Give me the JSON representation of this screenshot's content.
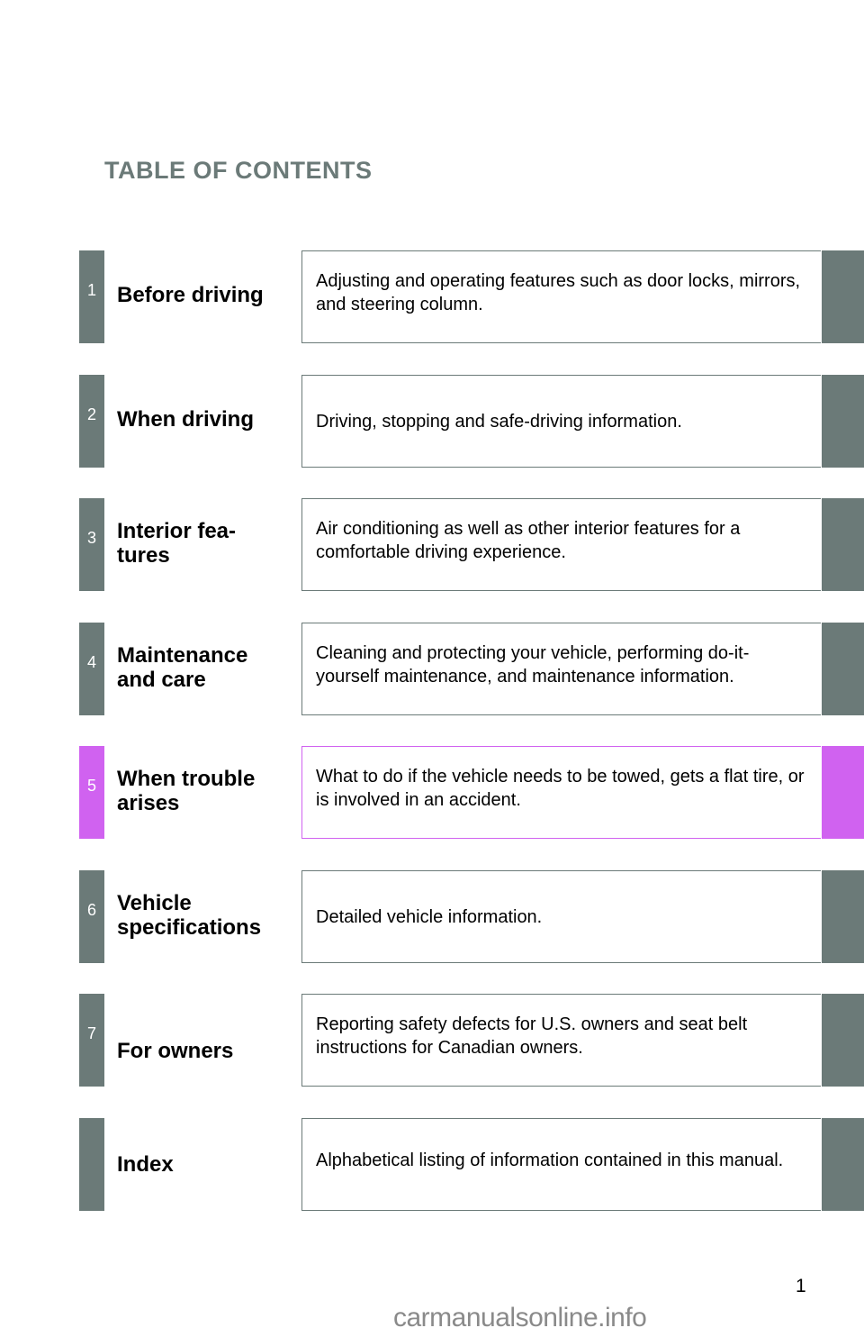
{
  "title": "TABLE OF CONTENTS",
  "accent_color": "#6b7a78",
  "active_color": "#d062f0",
  "sections": [
    {
      "number": "1",
      "heading": "Before driving",
      "description": "Adjusting and operating features such as door locks, mirrors, and steering column.",
      "active": false
    },
    {
      "number": "2",
      "heading": "When driving",
      "description": "Driving, stopping and safe-driving information.",
      "active": false
    },
    {
      "number": "3",
      "heading": "Interior fea- tures",
      "description": "Air conditioning as well as other interior features for a comfortable driving experience.",
      "active": false
    },
    {
      "number": "4",
      "heading": "Maintenance and care",
      "description": "Cleaning and protecting your vehicle, performing do-it-yourself maintenance, and maintenance information.",
      "active": false
    },
    {
      "number": "5",
      "heading": "When trouble arises",
      "description": "What to do if the vehicle needs to be towed, gets a flat tire, or is involved in an accident.",
      "active": true
    },
    {
      "number": "6",
      "heading": "Vehicle specifications",
      "description": "Detailed vehicle information.",
      "active": false
    },
    {
      "number": "7",
      "heading": "For owners",
      "description": "Reporting safety defects for U.S. owners and seat belt instructions for Canadian owners.",
      "active": false
    },
    {
      "number": "",
      "heading": "Index",
      "description": "Alphabetical listing of information contained in this manual.",
      "active": false
    }
  ],
  "page_number": "1",
  "watermark": "carmanualsonline.info"
}
